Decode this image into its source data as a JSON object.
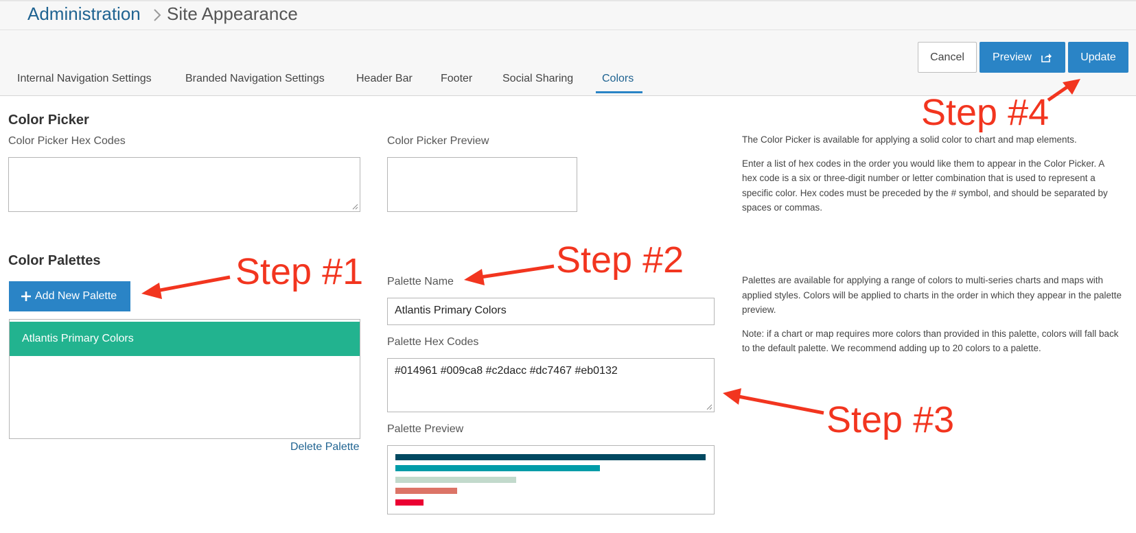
{
  "breadcrumb": {
    "root": "Administration",
    "current": "Site Appearance"
  },
  "toolbar": {
    "cancel_label": "Cancel",
    "preview_label": "Preview",
    "update_label": "Update"
  },
  "tabs": [
    {
      "label": "Internal Navigation Settings",
      "active": false
    },
    {
      "label": "Branded Navigation Settings",
      "active": false
    },
    {
      "label": "Header Bar",
      "active": false
    },
    {
      "label": "Footer",
      "active": false
    },
    {
      "label": "Social Sharing",
      "active": false
    },
    {
      "label": "Colors",
      "active": true
    }
  ],
  "color_picker": {
    "heading": "Color Picker",
    "hex_label": "Color Picker Hex Codes",
    "hex_value": "",
    "preview_label": "Color Picker Preview",
    "help_1": "The Color Picker is available for applying a solid color to chart and map elements.",
    "help_2": "Enter a list of hex codes in the order you would like them to appear in the Color Picker. A hex code is a six or three-digit number or letter combination that is used to represent a specific color. Hex codes must be preceded by the # symbol, and should be separated by spaces or commas."
  },
  "palettes": {
    "heading": "Color Palettes",
    "add_label": "Add New Palette",
    "items": [
      "Atlantis Primary Colors"
    ],
    "delete_label": "Delete Palette",
    "name_label": "Palette Name",
    "name_value": "Atlantis Primary Colors",
    "hex_label": "Palette Hex Codes",
    "hex_value": "#014961 #009ca8 #c2dacc #dc7467 #eb0132",
    "preview_label": "Palette Preview",
    "preview_colors": [
      "#014961",
      "#009ca8",
      "#c2dacc",
      "#dc7467",
      "#eb0132"
    ],
    "preview_levels": [
      1.0,
      0.66,
      0.39,
      0.2,
      0.09
    ],
    "help_1": "Palettes are available for applying a range of colors to multi-series charts and maps with applied styles. Colors will be applied to charts in the order in which they appear in the palette preview.",
    "help_2": "Note: if a chart or map requires more colors than provided in this palette, colors will fall back to the default palette. We recommend adding up to 20 colors to a palette."
  },
  "annotations": {
    "step1": "Step #1",
    "step2": "Step #2",
    "step3": "Step #3",
    "step4": "Step #4"
  },
  "colors": {
    "accent": "#2a84c6",
    "selected": "#22b38f",
    "annotation": "#f2351f",
    "link": "#1f6391"
  }
}
